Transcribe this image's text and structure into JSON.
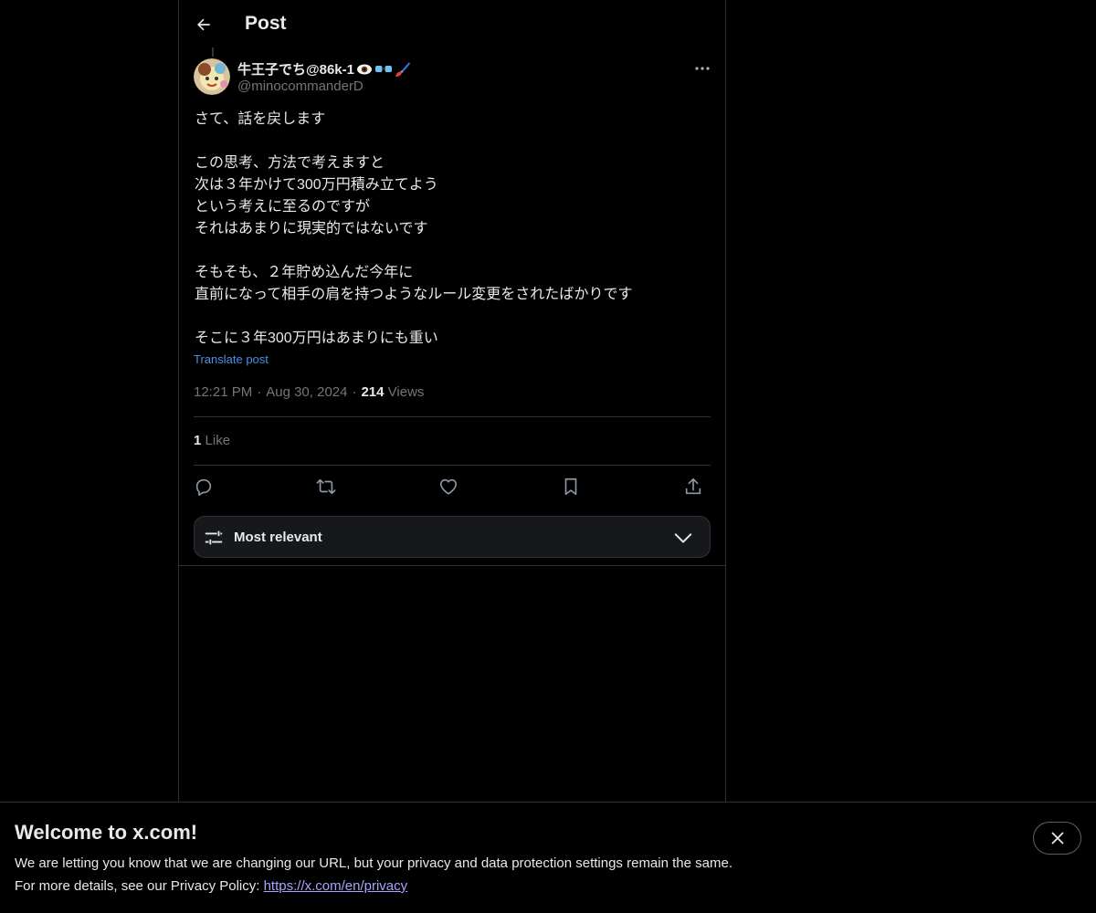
{
  "header": {
    "title": "Post"
  },
  "author": {
    "display_name": "牛王子でち@86k-1",
    "display_emojis": [
      "eye-emoji",
      "glasses-emoji",
      "paintbrush-emoji"
    ],
    "handle": "@minocommanderD"
  },
  "post": {
    "text": "さて、話を戻します\n\nこの思考、方法で考えますと\n次は３年かけて300万円積み立てよう\nという考えに至るのですが\nそれはあまりに現実的ではないです\n\nそもそも、２年貯め込んだ今年に\n直前になって相手の肩を持つようなルール変更をされたばかりです\n\nそこに３年300万円はあまりにも重い",
    "translate_label": "Translate post",
    "time": "12:21 PM",
    "date": "Aug 30, 2024",
    "views_count": "214",
    "views_label": "Views",
    "likes_count": "1",
    "likes_label": "Like"
  },
  "actions": [
    "reply-icon",
    "repost-icon",
    "like-icon",
    "bookmark-icon",
    "share-icon"
  ],
  "sort": {
    "label": "Most relevant"
  },
  "banner": {
    "title": "Welcome to x.com!",
    "line1": "We are letting you know that we are changing our URL, but your privacy and data protection settings remain the same.",
    "line2_prefix": "For more details, see our Privacy Policy: ",
    "link_text": "https://x.com/en/privacy"
  },
  "colors": {
    "background": "#000000",
    "text": "#e7e9ea",
    "muted": "#71767b",
    "link": "#4a8fe0",
    "border": "#2f3336"
  }
}
